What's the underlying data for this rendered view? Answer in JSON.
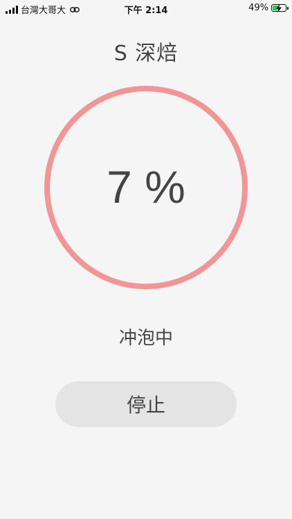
{
  "status_bar": {
    "carrier": "台灣大哥大",
    "time": "下午 2:14",
    "battery_percent_label": "49%",
    "battery_level": 0.49,
    "charging": true,
    "battery_fill_color": "#34c759"
  },
  "header": {
    "title": "S 深焙"
  },
  "progress": {
    "value_percent": 7,
    "label": "7 %",
    "ring_color": "#f29595"
  },
  "status_message": "冲泡中",
  "stop_button": {
    "label": "停止",
    "background": "#e4e4e4"
  },
  "icons": {
    "signal": "cellular-signal-icon",
    "link": "personal-hotspot-link-icon",
    "battery": "battery-charging-icon"
  },
  "colors": {
    "background": "#f5f5f5",
    "text": "#444444"
  }
}
